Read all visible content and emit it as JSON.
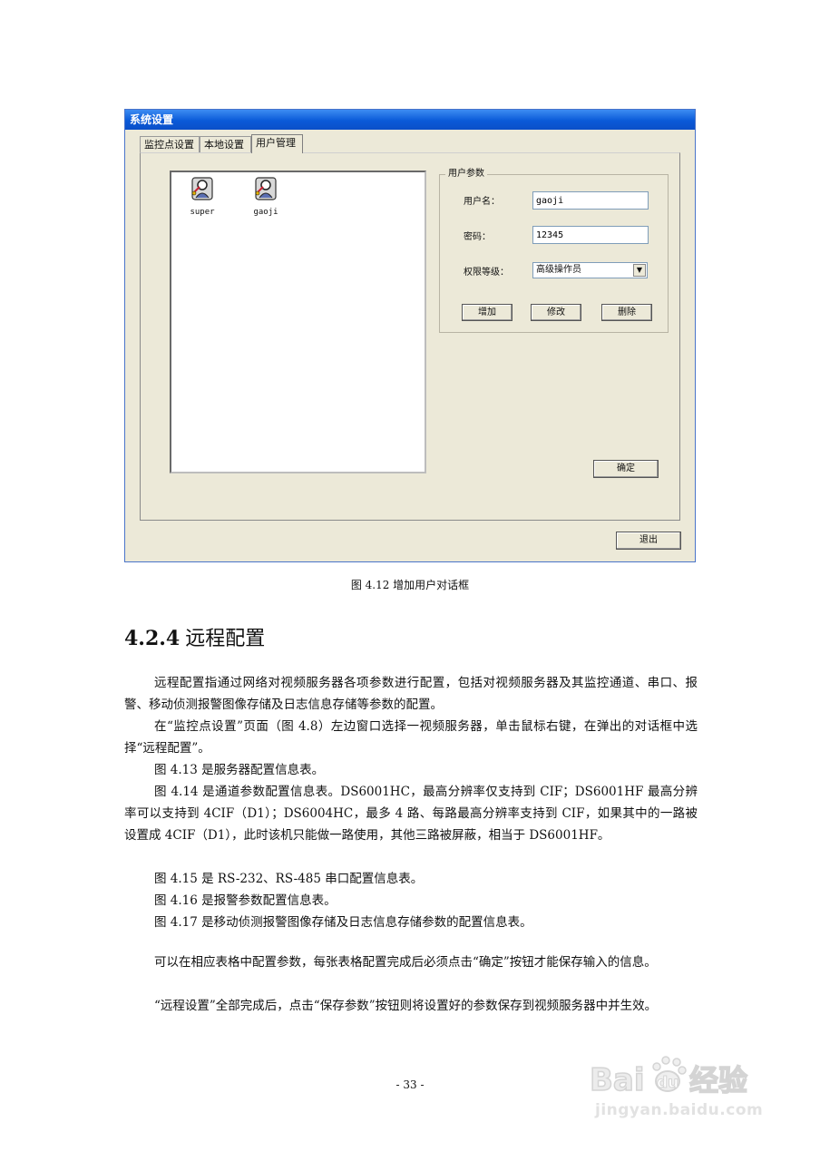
{
  "dialog": {
    "title": "系统设置",
    "tabs": [
      "监控点设置",
      "本地设置",
      "用户管理"
    ],
    "active_tab": "用户管理",
    "users": [
      {
        "name": "super",
        "icon": "user-key-icon"
      },
      {
        "name": "gaoji",
        "icon": "user-key-icon"
      }
    ],
    "group_label": "用户参数",
    "username_label": "用户名：",
    "username_value": "gaoji",
    "password_label": "密码：",
    "password_value": "12345",
    "level_label": "权限等级：",
    "level_value": "高级操作员",
    "add_label": "增加",
    "modify_label": "修改",
    "delete_label": "删除",
    "ok_label": "确定",
    "exit_label": "退出"
  },
  "caption": "图 4.12  增加用户对话框",
  "section": {
    "number": "4.2.4",
    "title": "远程配置"
  },
  "paragraphs": [
    "远程配置指通过网络对视频服务器各项参数进行配置，包括对视频服务器及其监控通道、串口、报警、移动侦测报警图像存储及日志信息存储等参数的配置。",
    "在“监控点设置”页面（图 4.8）左边窗口选择一视频服务器，单击鼠标右键，在弹出的对话框中选择“远程配置”。",
    "图 4.13 是服务器配置信息表。",
    "图 4.14 是通道参数配置信息表。DS6001HC，最高分辨率仅支持到 CIF；DS6001HF 最高分辨率可以支持到 4CIF（D1）；DS6004HC，最多 4 路、每路最高分辨率支持到 CIF，如果其中的一路被设置成 4CIF（D1），此时该机只能做一路使用，其他三路被屏蔽，相当于 DS6001HF。",
    "图 4.15 是 RS-232、RS-485 串口配置信息表。",
    "图 4.16 是报警参数配置信息表。",
    "图 4.17 是移动侦测报警图像存储及日志信息存储参数的配置信息表。",
    "可以在相应表格中配置参数，每张表格配置完成后必须点击“确定”按钮才能保存输入的信息。",
    "“远程设置”全部完成后，点击“保存参数”按钮则将设置好的参数保存到视频服务器中并生效。"
  ],
  "page_number": "- 33 -",
  "watermark": {
    "brand": "Baidu经验",
    "url": "jingyan.baidu.com"
  }
}
